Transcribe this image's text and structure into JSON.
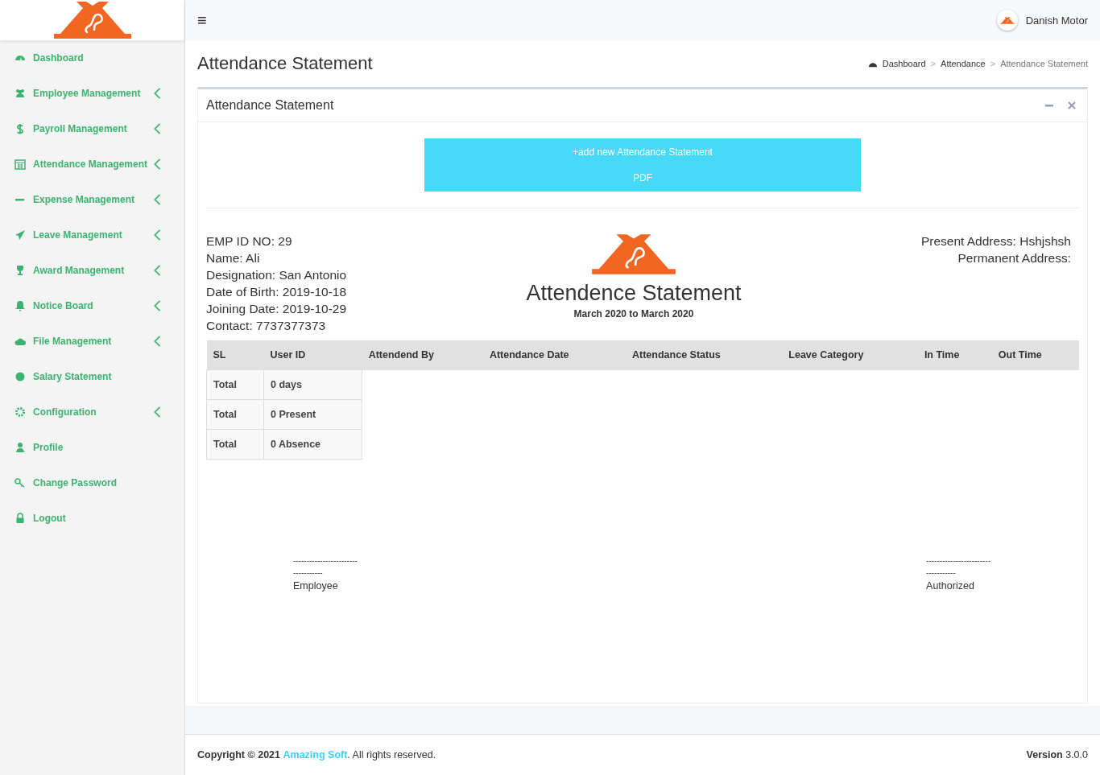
{
  "header": {
    "menu_glyph": "≡",
    "user": "Danish Motor"
  },
  "sidebar": {
    "items": [
      {
        "label": "Dashboard",
        "has_submenu": false
      },
      {
        "label": "Employee Management",
        "has_submenu": true
      },
      {
        "label": "Payroll Management",
        "has_submenu": true
      },
      {
        "label": "Attendance Management",
        "has_submenu": true
      },
      {
        "label": "Expense Management",
        "has_submenu": true
      },
      {
        "label": "Leave Management",
        "has_submenu": true
      },
      {
        "label": "Award Management",
        "has_submenu": true
      },
      {
        "label": "Notice Board",
        "has_submenu": true
      },
      {
        "label": "File Management",
        "has_submenu": true
      },
      {
        "label": "Salary Statement",
        "has_submenu": false
      },
      {
        "label": "Configuration",
        "has_submenu": true
      },
      {
        "label": "Profile",
        "has_submenu": false
      },
      {
        "label": "Change Password",
        "has_submenu": false
      },
      {
        "label": "Logout",
        "has_submenu": false
      }
    ]
  },
  "page_title": "Attendance Statement",
  "breadcrumb": [
    {
      "label": "Dashboard",
      "selected": false
    },
    {
      "label": "Attendance",
      "selected": false
    },
    {
      "label": "Attendance Statement",
      "selected": true
    }
  ],
  "breadcrumb_separator": ">",
  "box": {
    "title": "Attendance Statement",
    "action_buttons": [
      "+add new Attendance Statement",
      "PDF"
    ],
    "employee_info": [
      "EMP ID NO: 29",
      "Name: Ali",
      "Designation: San Antonio",
      "Date of Birth: 2019-10-18",
      "Joining Date: 2019-10-29",
      "Contact: 7737377373"
    ],
    "address_info": [
      "Present Address: Hshjshsh",
      "Permanent Address:"
    ],
    "statement_title": "Attendence Statement",
    "statement_period": "March 2020 to March 2020",
    "table": {
      "columns": [
        "SL",
        "User ID",
        "Attendend By",
        "Attendance Date",
        "Attendance Status",
        "Leave Category",
        "In Time",
        "Out Time"
      ],
      "summary_rows": [
        [
          "Total",
          "0 days"
        ],
        [
          "Total",
          "0 Present"
        ],
        [
          "Total",
          "0 Absence"
        ]
      ]
    },
    "signatures": [
      {
        "lines": [
          "------------------------",
          "-----------"
        ],
        "label": "Employee"
      },
      {
        "lines": [
          "------------------------",
          "-----------"
        ],
        "label": "Authorized"
      }
    ]
  },
  "footer": {
    "copyright": "Copyright © 2021",
    "company_link": "Amazing Soft",
    "rights": ". All rights reserved.",
    "version_label": "Version",
    "version": "3.0.0"
  }
}
